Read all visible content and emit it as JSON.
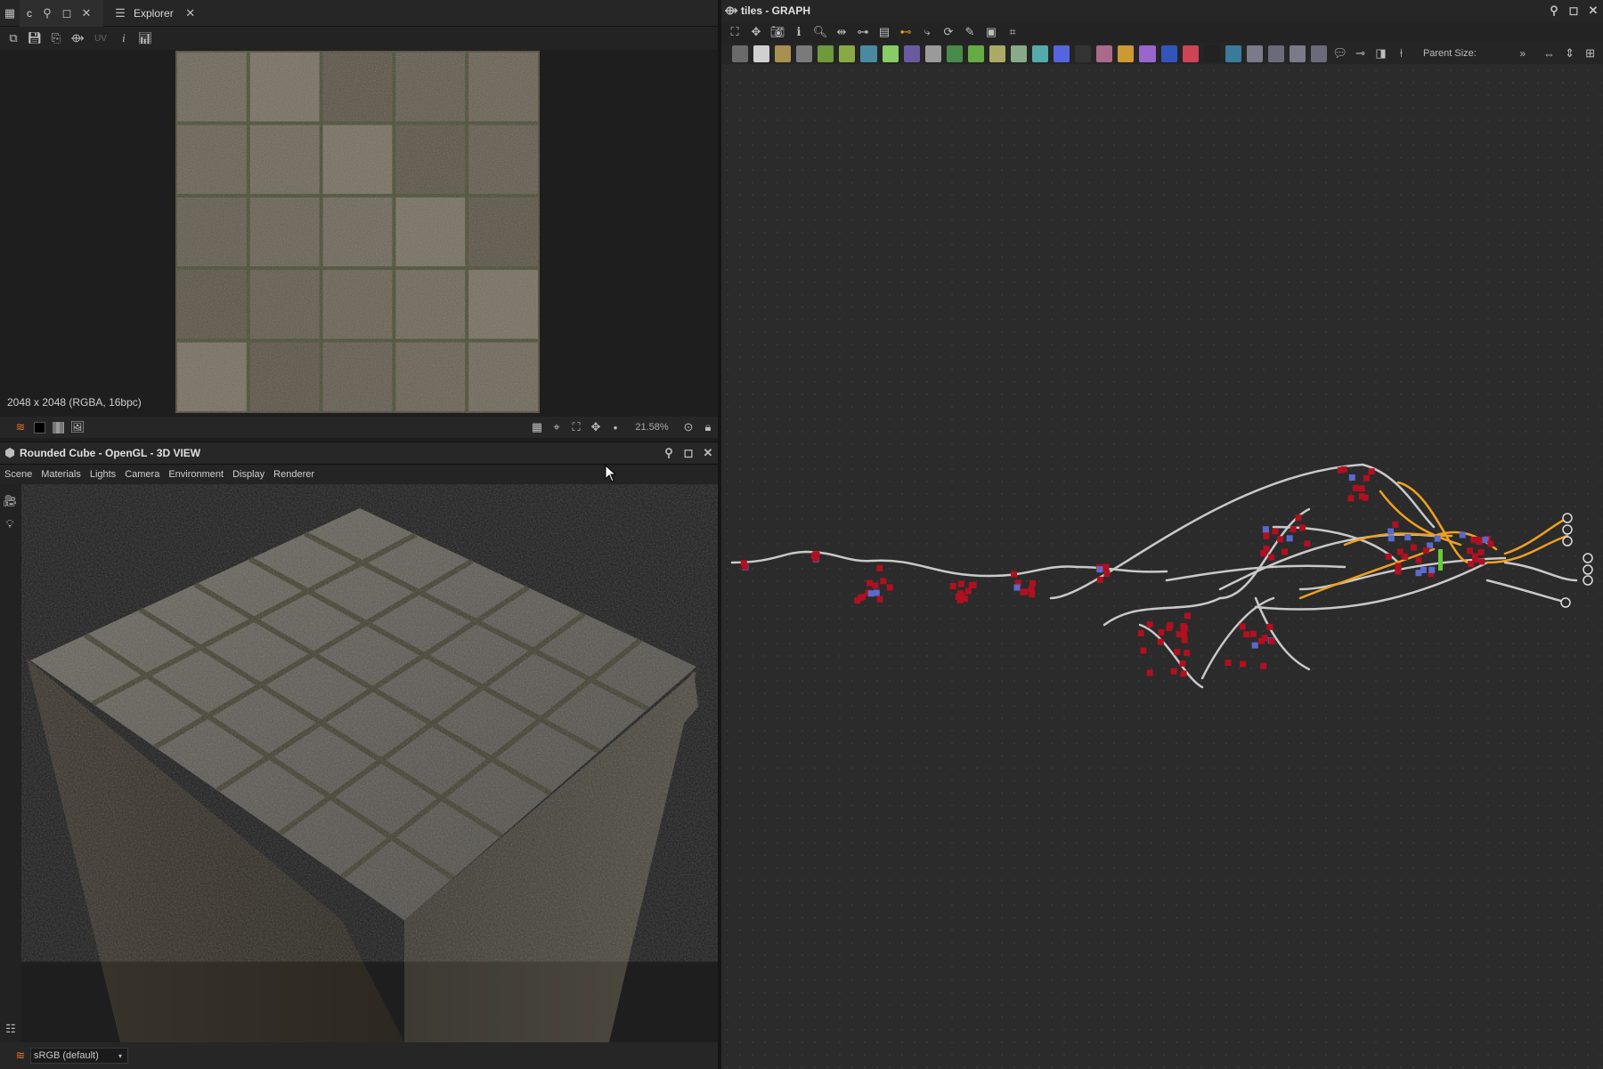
{
  "left_top": {
    "tabs": [
      {
        "label": "c"
      },
      {
        "label": "Explorer"
      }
    ],
    "toolbar_uv_label": "UV",
    "image_info": "2048 x 2048 (RGBA, 16bpc)",
    "zoom": "21.58%"
  },
  "view3d": {
    "title": "Rounded Cube - OpenGL - 3D VIEW",
    "menu": [
      "Scene",
      "Materials",
      "Lights",
      "Camera",
      "Environment",
      "Display",
      "Renderer"
    ],
    "colorspace": "sRGB (default)"
  },
  "graph": {
    "title": "tiles - GRAPH",
    "parent_size_label": "Parent Size:",
    "more_label": "»"
  },
  "colors": {
    "panel_bg": "#202020",
    "graph_bg": "#2b2b2b",
    "wire": "#c9c9c9",
    "wire_highlight": "#f0a020",
    "node_red": "#b01020"
  }
}
